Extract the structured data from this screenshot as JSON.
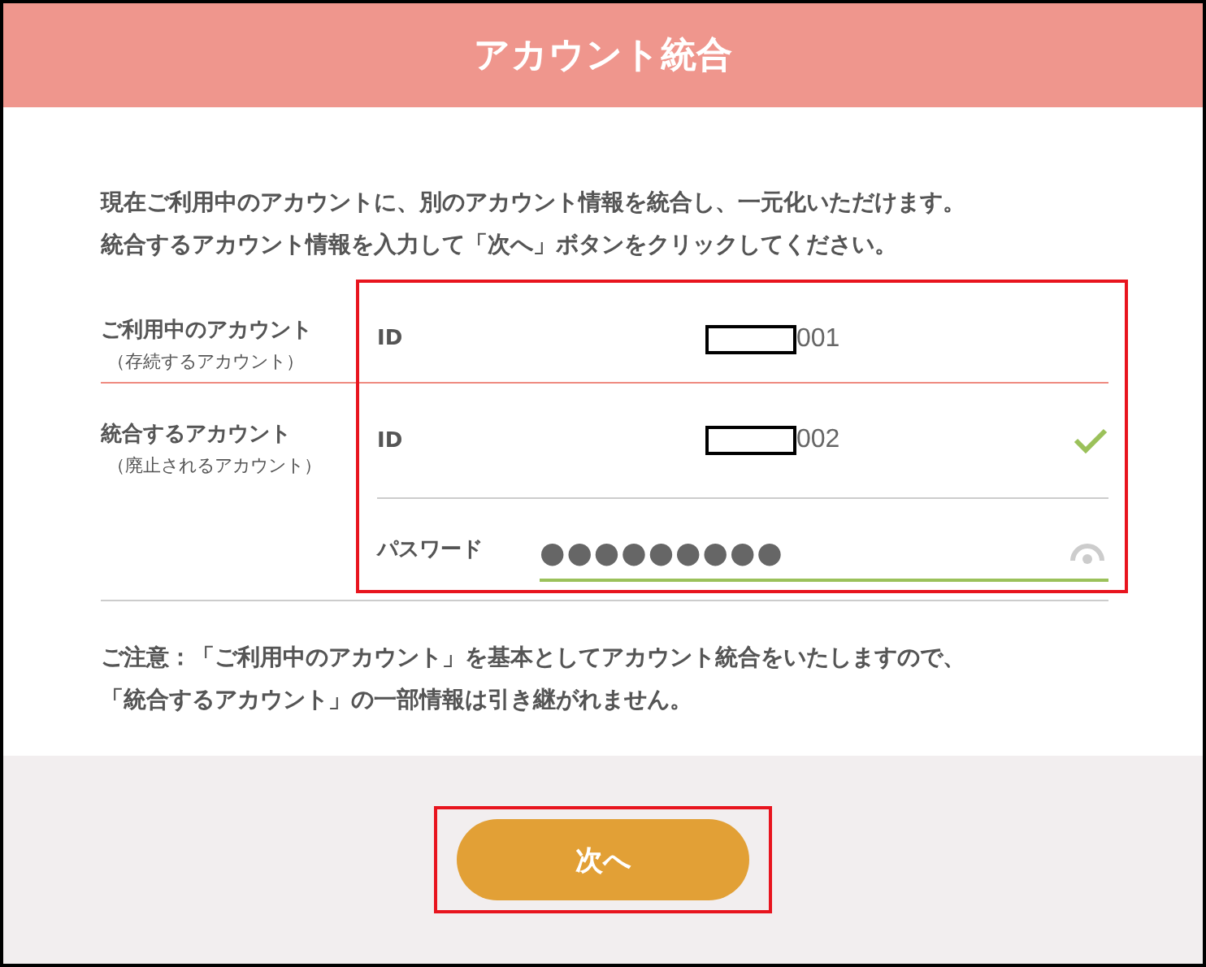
{
  "header": {
    "title": "アカウント統合"
  },
  "intro": [
    "現在ご利用中のアカウントに、別のアカウント情報を統合し、一元化いただけます。",
    "統合するアカウント情報を入力して「次へ」ボタンをクリックしてください。"
  ],
  "sections": [
    {
      "label": "ご利用中のアカウント",
      "sublabel": "（存続するアカウント）",
      "fields": [
        {
          "kind": "id",
          "label": "ID",
          "value": "001",
          "verified": false
        }
      ]
    },
    {
      "label": "統合するアカウント",
      "sublabel": "（廃止されるアカウント）",
      "fields": [
        {
          "kind": "id",
          "label": "ID",
          "value": "002",
          "verified": true
        },
        {
          "kind": "password",
          "label": "パスワード",
          "value": "●●●●●●●●●",
          "focused": true
        }
      ]
    }
  ],
  "notice": [
    "ご注意：「ご利用中のアカウント」を基本としてアカウント統合をいたしますので、",
    "「統合するアカウント」の一部情報は引き継がれません。"
  ],
  "next_button": {
    "label": "次へ"
  }
}
